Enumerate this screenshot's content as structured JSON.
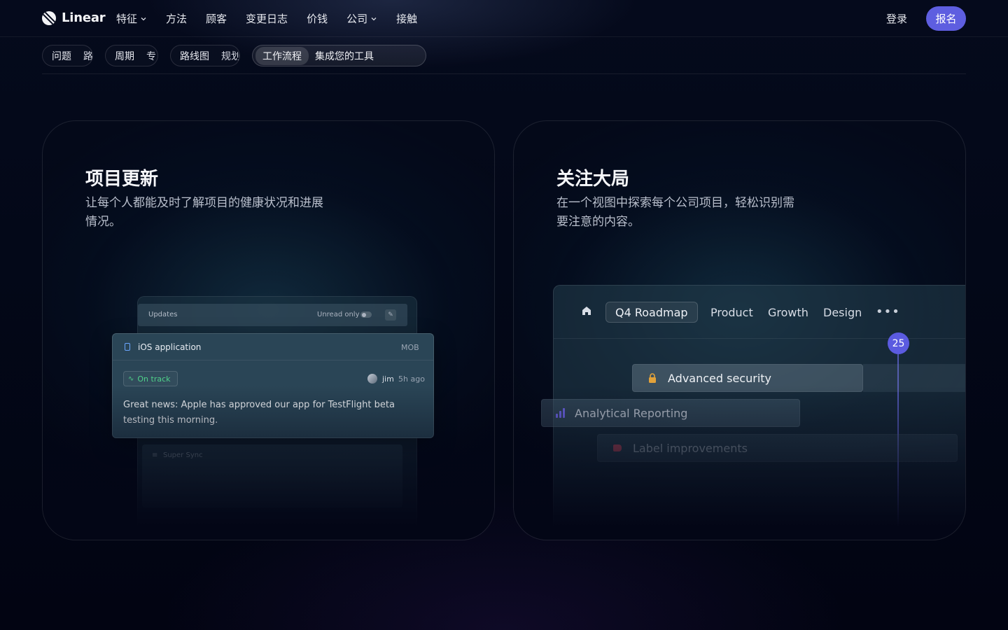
{
  "nav": {
    "logo_text": "Linear",
    "links": [
      {
        "label": "特征",
        "dropdown": true
      },
      {
        "label": "方法",
        "dropdown": false
      },
      {
        "label": "顾客",
        "dropdown": false
      },
      {
        "label": "变更日志",
        "dropdown": false
      },
      {
        "label": "价钱",
        "dropdown": false
      },
      {
        "label": "公司",
        "dropdown": true
      },
      {
        "label": "接触",
        "dropdown": false
      }
    ],
    "login_label": "登录",
    "signup_label": "报名",
    "signup_color": "#5e5ee0"
  },
  "tabs": [
    {
      "label": "问题",
      "sub": "路"
    },
    {
      "label": "周期",
      "sub": "专"
    },
    {
      "label": "路线图",
      "sub": "规划"
    },
    {
      "label": "工作流程",
      "sub": "集成您的工具",
      "active": true
    }
  ],
  "left_card": {
    "title": "项目更新",
    "description": "让每个人都能及时了解项目的健康状况和进展情况。",
    "mock": {
      "header_label": "Updates",
      "unread_label": "Unread only",
      "project_name": "iOS application",
      "project_code": "MOB",
      "status": "On track",
      "status_color": "#4fd28a",
      "author": "jim",
      "time_ago": "5h ago",
      "message": "Great news: Apple has approved our app for TestFlight beta testing this morning.",
      "faded_item": "Super Sync"
    }
  },
  "right_card": {
    "title": "关注大局",
    "description": "在一个视图中探索每个公司项目，轻松识别需要注意的内容。",
    "mock": {
      "tabs": [
        {
          "label": "Q4 Roadmap",
          "active": true
        },
        {
          "label": "Product"
        },
        {
          "label": "Growth"
        },
        {
          "label": "Design"
        }
      ],
      "date_marker": "25",
      "date_marker_color": "#5b5be0",
      "bars": [
        {
          "label": "Advanced security",
          "icon": "lock-icon"
        },
        {
          "label": "Analytical Reporting",
          "icon": "chart-icon"
        },
        {
          "label": "Label improvements",
          "icon": "tag-icon"
        }
      ]
    }
  }
}
